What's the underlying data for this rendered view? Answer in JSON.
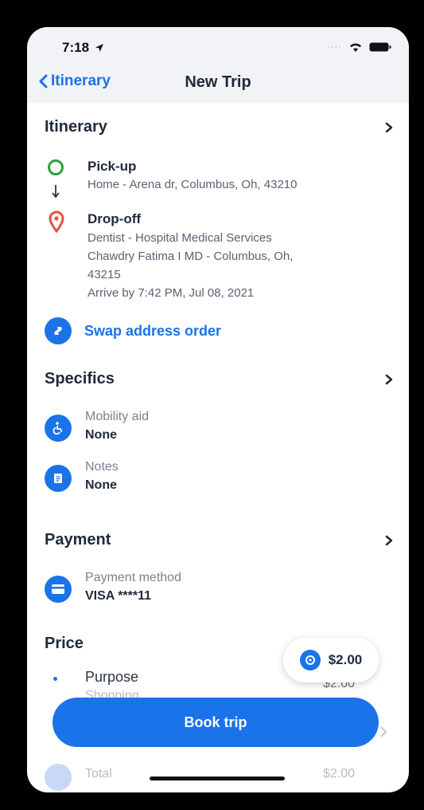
{
  "status_bar": {
    "time": "7:18"
  },
  "nav": {
    "back_label": "Itinerary",
    "title": "New Trip"
  },
  "itinerary": {
    "title": "Itinerary",
    "pickup": {
      "label": "Pick-up",
      "address": "Home - Arena dr, Columbus, Oh, 43210"
    },
    "dropoff": {
      "label": "Drop-off",
      "line1": "Dentist - Hospital Medical Services",
      "line2": "Chawdry Fatima I MD - Columbus, Oh,",
      "line3": "43215",
      "arrive": "Arrive by 7:42 PM, Jul 08, 2021"
    },
    "swap_label": "Swap address order"
  },
  "specifics": {
    "title": "Specifics",
    "mobility": {
      "title": "Mobility aid",
      "value": "None"
    },
    "notes": {
      "title": "Notes",
      "value": "None"
    }
  },
  "payment": {
    "title": "Payment",
    "method": {
      "title": "Payment method",
      "value": "VISA ****11"
    }
  },
  "price": {
    "title": "Price",
    "purpose_label": "Purpose",
    "purpose_value": "Shopping",
    "purpose_amount": "$2.00",
    "total_label": "Total",
    "total_amount": "$2.00",
    "pill_amount": "$2.00"
  },
  "book_button": "Book trip",
  "colors": {
    "accent": "#1a73e8",
    "pickup": "#2ea044",
    "dropoff": "#e5533d"
  }
}
